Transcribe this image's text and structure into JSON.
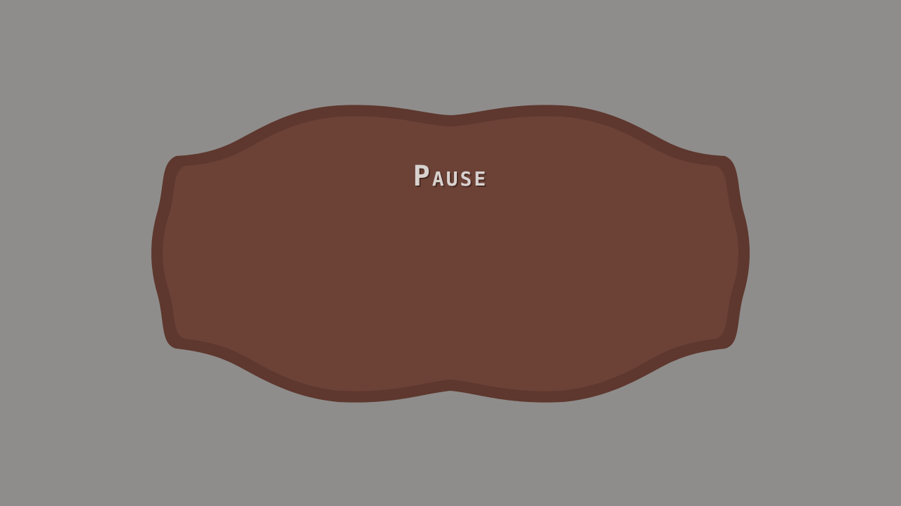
{
  "screen": {
    "title": "Pause"
  },
  "colors": {
    "background": "#8e8d8b",
    "panel_fill": "#6c4237",
    "panel_border": "#5e372e",
    "title_text": "#d8d2cf"
  }
}
